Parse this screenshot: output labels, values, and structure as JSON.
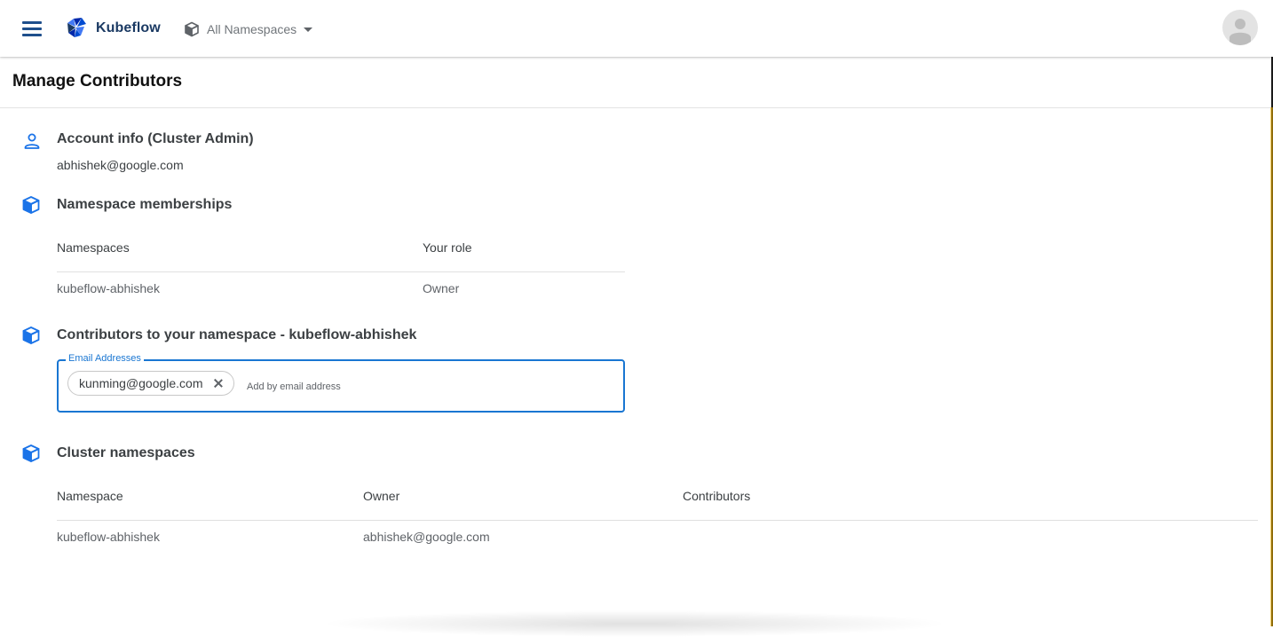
{
  "app": {
    "brand": "Kubeflow",
    "namespace_selector": "All Namespaces"
  },
  "page": {
    "title": "Manage Contributors"
  },
  "account": {
    "title": "Account info  (Cluster Admin)",
    "email": "abhishek@google.com"
  },
  "memberships": {
    "title": "Namespace memberships",
    "columns": [
      "Namespaces",
      "Your role"
    ],
    "rows": [
      [
        "kubeflow-abhishek",
        "Owner"
      ]
    ]
  },
  "contributors": {
    "title": "Contributors to your namespace - kubeflow-abhishek",
    "field_label": "Email Addresses",
    "chips": [
      "kunming@google.com"
    ],
    "input_placeholder": "Add by email address"
  },
  "cluster": {
    "title": "Cluster namespaces",
    "columns": [
      "Namespace",
      "Owner",
      "Contributors"
    ],
    "rows": [
      [
        "kubeflow-abhishek",
        "abhishek@google.com",
        ""
      ]
    ]
  },
  "colors": {
    "accent": "#1976d2",
    "brand_dark": "#1b3a63",
    "icon_blue": "#1a73e8"
  }
}
